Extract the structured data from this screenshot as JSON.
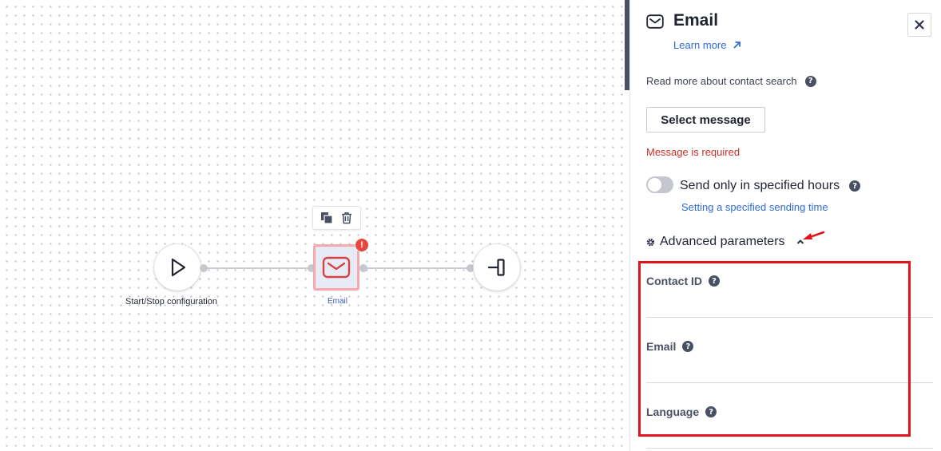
{
  "canvas": {
    "nodes": {
      "start": {
        "label": "Start/Stop configuration",
        "icon": "play-icon"
      },
      "email": {
        "label": "Email",
        "icon": "mail-icon",
        "error_badge": "!"
      },
      "end": {
        "icon": "exit-icon"
      }
    },
    "toolbar": {
      "copy_icon": "copy-icon",
      "delete_icon": "trash-icon"
    }
  },
  "panel": {
    "title": "Email",
    "title_icon": "mail-icon",
    "learn_more": "Learn more",
    "close_icon": "close-icon",
    "read_more": "Read more about contact search",
    "select_message": "Select message",
    "error": "Message is required",
    "send_only": "Send only in specified hours",
    "send_only_enabled": false,
    "setting_link": "Setting a specified sending time",
    "advanced": "Advanced parameters",
    "fields": [
      {
        "label": "Contact ID",
        "value": ""
      },
      {
        "label": "Email",
        "value": ""
      },
      {
        "label": "Language",
        "value": ""
      }
    ]
  },
  "colors": {
    "link": "#2f6bd9",
    "error": "#c9312a",
    "highlight": "#e3141c",
    "email_node_border": "#f5a9ab"
  }
}
